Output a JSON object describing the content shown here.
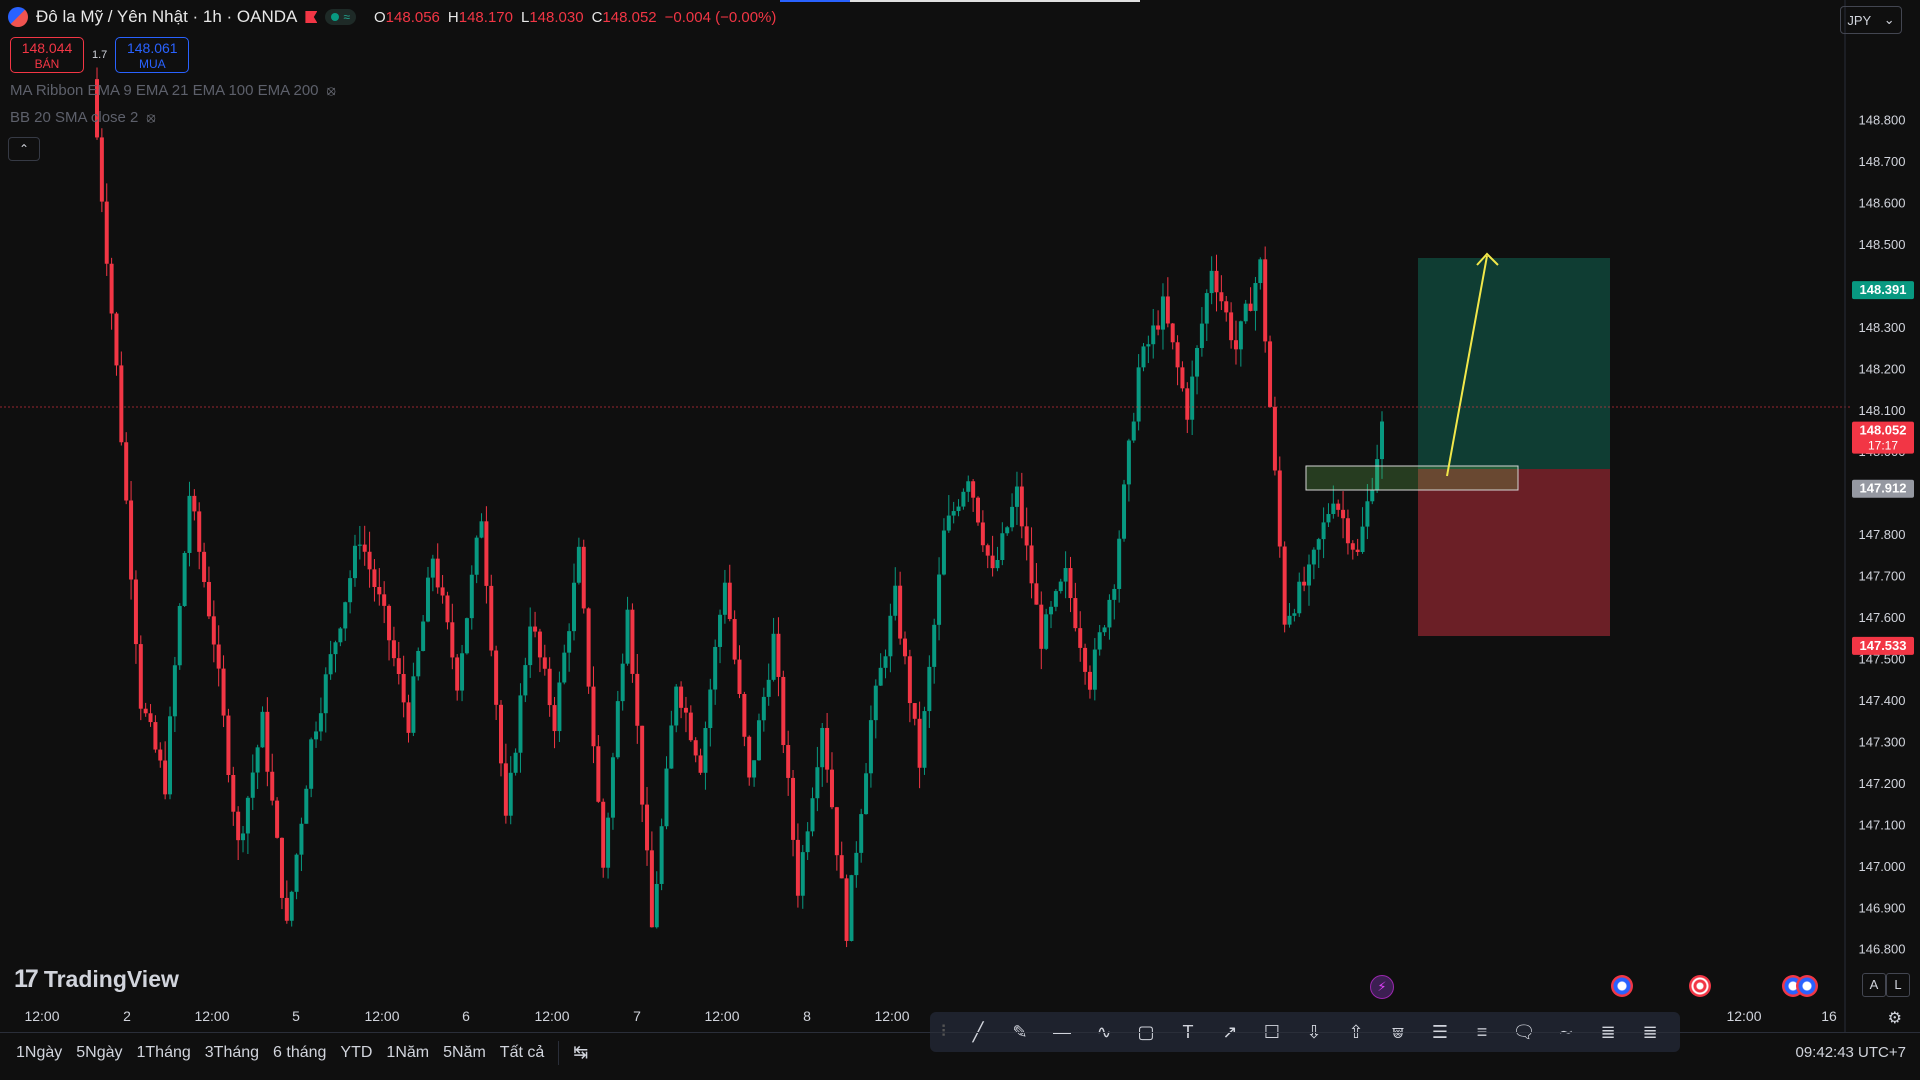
{
  "header": {
    "symbol": "Đô la Mỹ / Yên Nhật · 1h · OANDA",
    "ohlc": [
      {
        "label": "O",
        "value": "148.056"
      },
      {
        "label": "H",
        "value": "148.170"
      },
      {
        "label": "L",
        "value": "148.030"
      },
      {
        "label": "C",
        "value": "148.052"
      }
    ],
    "change": "−0.004 (−0.00%)",
    "status_symbol": "≈"
  },
  "trade": {
    "sell_price": "148.044",
    "sell_label": "BÁN",
    "spread": "1.7",
    "buy_price": "148.061",
    "buy_label": "MUA"
  },
  "indicators": {
    "ma_ribbon": "MA Ribbon EMA 9 EMA 21 EMA 100 EMA 200",
    "bb": "BB 20 SMA close 2"
  },
  "currency": "JPY",
  "logo_text": "TradingView",
  "timeframes": [
    "1Ngày",
    "5Ngày",
    "1Tháng",
    "3Tháng",
    "6 tháng",
    "YTD",
    "1Năm",
    "5Năm",
    "Tất cả"
  ],
  "clock": "09:42:43 UTC+7",
  "scale_buttons": [
    "A",
    "L"
  ],
  "colors": {
    "background": "#0f0f0f",
    "up": "#089981",
    "down": "#f23645",
    "profit_zone": "#0f3d33",
    "loss_zone": "#6b1f26",
    "arrow": "#f2e84a"
  },
  "chart_data": {
    "type": "candlestick",
    "instrument": "USD/JPY",
    "interval": "1h",
    "ylim": [
      146.78,
      148.91
    ],
    "y_ticks": [
      "148.800",
      "148.700",
      "148.600",
      "148.500",
      "148.400",
      "148.300",
      "148.200",
      "148.100",
      "148.000",
      "147.900",
      "147.800",
      "147.700",
      "147.600",
      "147.500",
      "147.400",
      "147.300",
      "147.200",
      "147.100",
      "147.000",
      "146.900",
      "146.800"
    ],
    "x_ticks": [
      "12:00",
      "2",
      "12:00",
      "5",
      "12:00",
      "6",
      "12:00",
      "7",
      "12:00",
      "8",
      "12:00",
      "12:00",
      "16"
    ],
    "price_labels": {
      "target": "148.391",
      "last": "148.052",
      "countdown": "17:17",
      "entry": "147.912",
      "stop": "147.533"
    },
    "position": {
      "entry": 147.912,
      "target": 148.391,
      "stop": 147.533
    },
    "segments": [
      [
        148.9,
        148.2
      ],
      [
        148.2,
        147.4
      ],
      [
        147.4,
        147.2
      ],
      [
        147.2,
        147.9
      ],
      [
        147.9,
        147.55
      ],
      [
        147.55,
        147.05
      ],
      [
        147.05,
        147.35
      ],
      [
        147.35,
        146.85
      ],
      [
        146.85,
        147.3
      ],
      [
        147.3,
        147.55
      ],
      [
        147.55,
        147.8
      ],
      [
        147.8,
        147.6
      ],
      [
        147.6,
        147.35
      ],
      [
        147.35,
        147.75
      ],
      [
        147.75,
        147.45
      ],
      [
        147.45,
        147.85
      ],
      [
        147.85,
        147.1
      ],
      [
        147.1,
        147.6
      ],
      [
        147.6,
        147.35
      ],
      [
        147.35,
        147.75
      ],
      [
        147.75,
        147.0
      ],
      [
        147.0,
        147.65
      ],
      [
        147.65,
        146.85
      ],
      [
        146.85,
        147.45
      ],
      [
        147.45,
        147.25
      ],
      [
        147.25,
        147.7
      ],
      [
        147.7,
        147.2
      ],
      [
        147.2,
        147.55
      ],
      [
        147.55,
        146.95
      ],
      [
        146.95,
        147.35
      ],
      [
        147.35,
        146.85
      ],
      [
        146.85,
        147.35
      ],
      [
        147.35,
        147.65
      ],
      [
        147.65,
        147.25
      ],
      [
        147.25,
        147.8
      ],
      [
        147.8,
        147.95
      ],
      [
        147.95,
        147.7
      ],
      [
        147.7,
        147.9
      ],
      [
        147.9,
        147.55
      ],
      [
        147.55,
        147.7
      ],
      [
        147.7,
        147.45
      ],
      [
        147.45,
        147.7
      ],
      [
        147.7,
        148.2
      ],
      [
        148.2,
        148.35
      ],
      [
        148.35,
        148.1
      ],
      [
        148.1,
        148.45
      ],
      [
        148.45,
        148.25
      ],
      [
        148.25,
        148.45
      ],
      [
        148.45,
        147.6
      ],
      [
        147.6,
        147.7
      ],
      [
        147.7,
        147.9
      ],
      [
        147.9,
        147.75
      ],
      [
        147.75,
        148.06
      ]
    ]
  }
}
